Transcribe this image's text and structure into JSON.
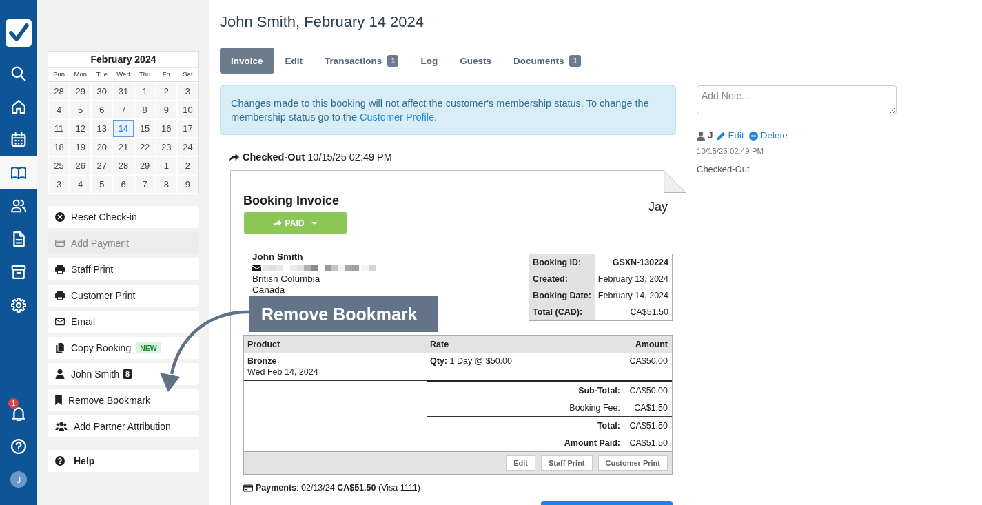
{
  "nav": {
    "items": [
      {
        "kind": "search",
        "selected": false
      },
      {
        "kind": "home",
        "selected": false
      },
      {
        "kind": "calendar",
        "selected": false
      },
      {
        "kind": "book",
        "selected": true
      },
      {
        "kind": "users",
        "selected": false
      },
      {
        "kind": "document",
        "selected": false
      },
      {
        "kind": "archive",
        "selected": false
      },
      {
        "kind": "settings",
        "selected": false
      }
    ],
    "notifications": {
      "badge": "1"
    },
    "avatar": {
      "initial": "J"
    }
  },
  "calendar": {
    "title": "February 2024",
    "weekdays": [
      "Sun",
      "Mon",
      "Tue",
      "Wed",
      "Thu",
      "Fri",
      "Sat"
    ],
    "days": [
      {
        "label": "28",
        "selected": false
      },
      {
        "label": "29",
        "selected": false
      },
      {
        "label": "30",
        "selected": false
      },
      {
        "label": "31",
        "selected": false
      },
      {
        "label": "1",
        "selected": false
      },
      {
        "label": "2",
        "selected": false
      },
      {
        "label": "3",
        "selected": false
      },
      {
        "label": "4",
        "selected": false
      },
      {
        "label": "5",
        "selected": false
      },
      {
        "label": "6",
        "selected": false
      },
      {
        "label": "7",
        "selected": false
      },
      {
        "label": "8",
        "selected": false
      },
      {
        "label": "9",
        "selected": false
      },
      {
        "label": "10",
        "selected": false
      },
      {
        "label": "11",
        "selected": false
      },
      {
        "label": "12",
        "selected": false
      },
      {
        "label": "13",
        "selected": false
      },
      {
        "label": "14",
        "selected": true
      },
      {
        "label": "15",
        "selected": false
      },
      {
        "label": "16",
        "selected": false
      },
      {
        "label": "17",
        "selected": false
      },
      {
        "label": "18",
        "selected": false
      },
      {
        "label": "19",
        "selected": false
      },
      {
        "label": "20",
        "selected": false
      },
      {
        "label": "21",
        "selected": false
      },
      {
        "label": "22",
        "selected": false
      },
      {
        "label": "23",
        "selected": false
      },
      {
        "label": "24",
        "selected": false
      },
      {
        "label": "25",
        "selected": false
      },
      {
        "label": "26",
        "selected": false
      },
      {
        "label": "27",
        "selected": false
      },
      {
        "label": "28",
        "selected": false
      },
      {
        "label": "29",
        "selected": false
      },
      {
        "label": "1",
        "selected": false
      },
      {
        "label": "2",
        "selected": false
      },
      {
        "label": "3",
        "selected": false
      },
      {
        "label": "4",
        "selected": false
      },
      {
        "label": "5",
        "selected": false
      },
      {
        "label": "6",
        "selected": false
      },
      {
        "label": "7",
        "selected": false
      },
      {
        "label": "8",
        "selected": false
      },
      {
        "label": "9",
        "selected": false
      }
    ]
  },
  "actions": [
    {
      "kind": "reset",
      "label": "Reset Check-in",
      "disabled": false
    },
    {
      "kind": "payment",
      "label": "Add Payment",
      "disabled": true
    },
    {
      "kind": "print",
      "label": "Staff Print",
      "disabled": false
    },
    {
      "kind": "print",
      "label": "Customer Print",
      "disabled": false
    },
    {
      "kind": "email",
      "label": "Email",
      "disabled": false
    },
    {
      "kind": "copy",
      "label": "Copy Booking",
      "tag": "NEW",
      "disabled": false
    },
    {
      "kind": "person",
      "label": "John Smith",
      "badge": "8",
      "disabled": false
    },
    {
      "kind": "bookmark",
      "label": "Remove Bookmark",
      "disabled": false
    },
    {
      "kind": "group",
      "label": "Add Partner Attribution",
      "disabled": false
    }
  ],
  "help_button": {
    "label": "Help"
  },
  "page": {
    "title": "John Smith, February 14 2024"
  },
  "tabs": [
    {
      "label": "Invoice",
      "selected": true
    },
    {
      "label": "Edit",
      "selected": false
    },
    {
      "label": "Transactions",
      "badge": "1",
      "selected": false
    },
    {
      "label": "Log",
      "selected": false
    },
    {
      "label": "Guests",
      "selected": false
    },
    {
      "label": "Documents",
      "badge": "1",
      "selected": false
    }
  ],
  "alert": {
    "text": "Changes made to this booking will not affect the customer's membership status. To change the membership status go to the ",
    "link": "Customer Profile",
    "end": "."
  },
  "status": "**Checked-Out** 10/15/25 02:49 PM",
  "invoice": {
    "title": "Booking Invoice",
    "account": "Jay",
    "status_button": {
      "label": "PAID"
    },
    "customer": {
      "name": "John Smith",
      "lines": [
        "British Columbia",
        "Canada"
      ]
    },
    "details": [
      {
        "label": "Booking ID:",
        "value": "GSXN-130224",
        "bold": true
      },
      {
        "label": "Created:",
        "value": "February 13, 2024",
        "bold": false
      },
      {
        "label": "Booking Date:",
        "value": "February 14, 2024",
        "bold": false
      },
      {
        "label": "Total (CAD):",
        "value": "CA$51.50",
        "bold": false
      }
    ],
    "columns": [
      "Product",
      "Rate",
      "Amount"
    ],
    "rows": [
      {
        "product": "Bronze",
        "date": "Wed Feb 14, 2024",
        "rate": "**Qty:** 1 Day @ $50.00",
        "amount": "CA$50.00"
      }
    ],
    "totals": [
      {
        "rows": [
          {
            "label": "Sub-Total:",
            "value": "CA$50.00",
            "bold": true
          },
          {
            "label": "Booking Fee:",
            "value": "CA$1.50",
            "bold": false
          }
        ]
      },
      {
        "rows": [
          {
            "label": "Total:",
            "value": "CA$51.50",
            "bold": true
          },
          {
            "label": "Amount Paid:",
            "value": "CA$51.50",
            "bold": true
          }
        ]
      }
    ],
    "actions": [
      "Edit",
      "Staff Print",
      "Customer Print"
    ],
    "payments": "**Payments**: 02/13/24 **CA$51.50** (Visa 1111)"
  },
  "notes": {
    "placeholder": "Add Note...",
    "entries": [
      {
        "author": "J",
        "edit": "Edit",
        "delete": "Delete",
        "time": "10/15/25 02:49 PM",
        "text": "Checked-Out"
      }
    ]
  },
  "annotation": {
    "label": "Remove Bookmark"
  }
}
